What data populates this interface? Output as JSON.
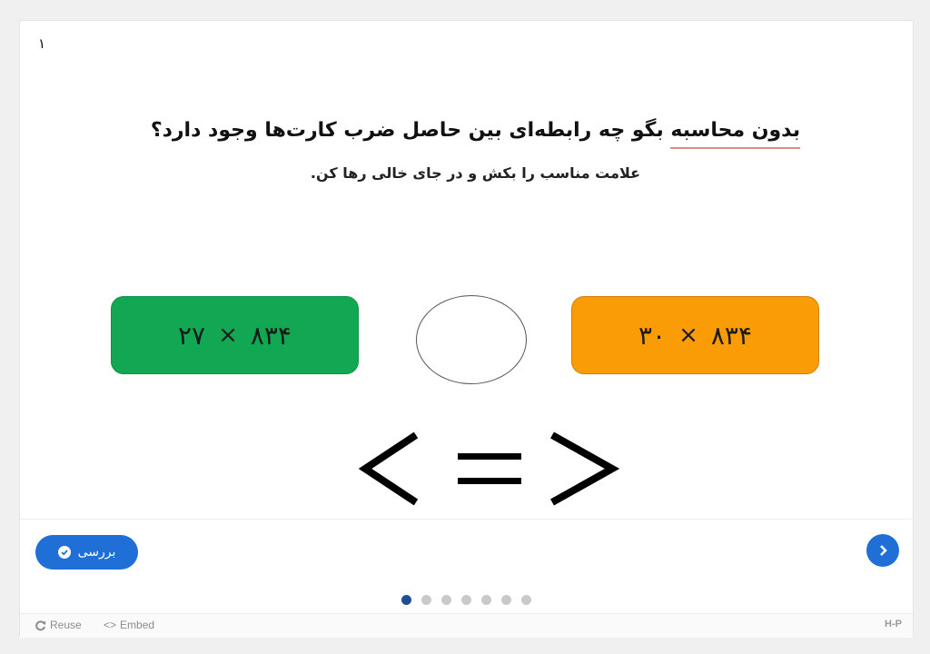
{
  "slide": {
    "number": "۱",
    "title_prefix": "بدون محاسبه",
    "title_rest": " بگو چه رابطه‌ای بین حاصل ضرب کارت‌ها وجود دارد؟",
    "subtitle": "علامت مناسب را بکش و در جای خالی رها کن."
  },
  "cards": {
    "left": {
      "a": "۸۳۴",
      "op": "×",
      "b": "۲۷",
      "color": "#12a853"
    },
    "right": {
      "a": "۸۳۴",
      "op": "×",
      "b": "۳۰",
      "color": "#f99c05"
    }
  },
  "drop_zone": {
    "label": ""
  },
  "draggables": [
    "<",
    "=",
    ">"
  ],
  "nav": {
    "check_label": "بررسی",
    "check_icon": "check-circle-icon",
    "next_icon": "chevron-right-icon",
    "pages_total": 7,
    "current_page": 1,
    "accent": "#1f6fd6"
  },
  "footer": {
    "reuse_label": "Reuse",
    "embed_label": "Embed",
    "logo": "H-P"
  }
}
